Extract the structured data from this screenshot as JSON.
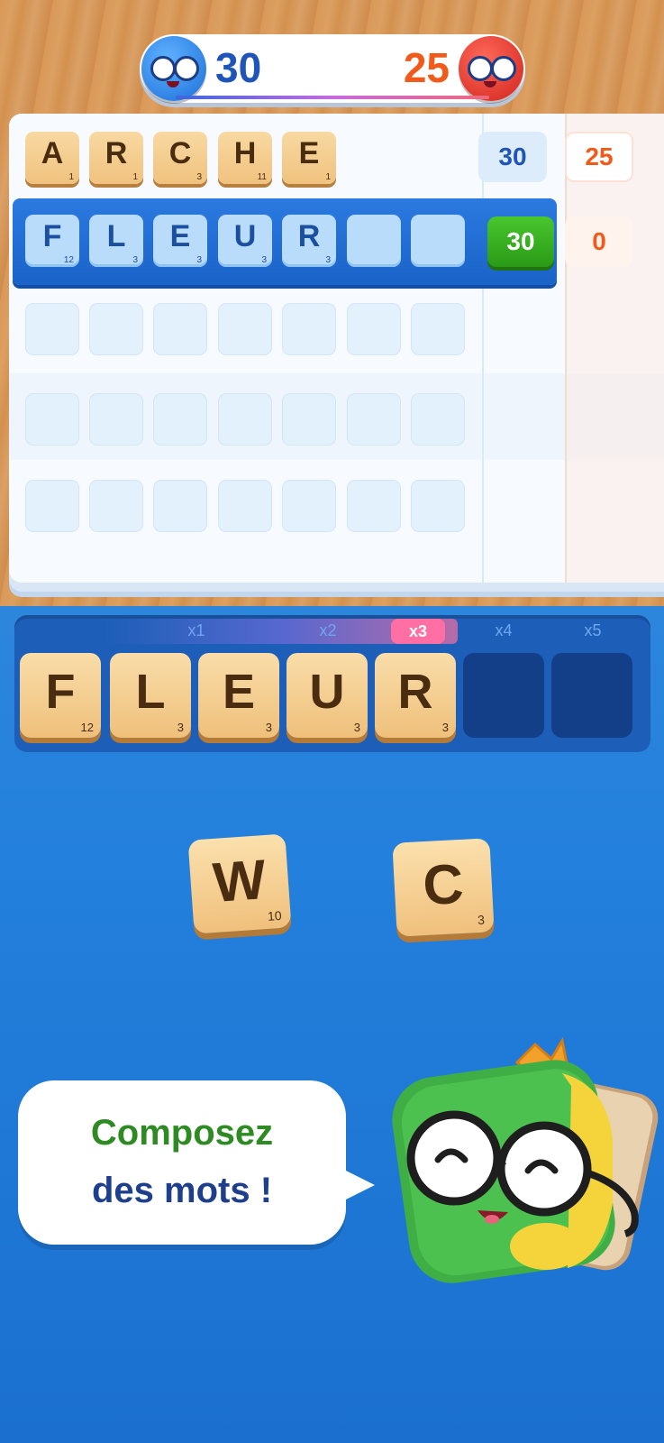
{
  "header": {
    "player1_score": "30",
    "player2_score": "25"
  },
  "board": {
    "rows": [
      {
        "tiles": [
          {
            "letter": "A",
            "points": "1"
          },
          {
            "letter": "R",
            "points": "1"
          },
          {
            "letter": "C",
            "points": "3"
          },
          {
            "letter": "H",
            "points": "11"
          },
          {
            "letter": "E",
            "points": "1"
          }
        ],
        "p1_score": "30",
        "p2_score": "25"
      },
      {
        "tiles": [
          {
            "letter": "F",
            "points": "12"
          },
          {
            "letter": "L",
            "points": "3"
          },
          {
            "letter": "E",
            "points": "3"
          },
          {
            "letter": "U",
            "points": "3"
          },
          {
            "letter": "R",
            "points": "3"
          }
        ],
        "p1_score": "30",
        "p2_score": "0"
      }
    ]
  },
  "rack": {
    "multipliers": [
      "x1",
      "x2",
      "x3",
      "x4",
      "x5"
    ],
    "tiles": [
      {
        "letter": "F",
        "points": "12"
      },
      {
        "letter": "L",
        "points": "3"
      },
      {
        "letter": "E",
        "points": "3"
      },
      {
        "letter": "U",
        "points": "3"
      },
      {
        "letter": "R",
        "points": "3"
      }
    ]
  },
  "loose_tiles": [
    {
      "letter": "W",
      "points": "10"
    },
    {
      "letter": "C",
      "points": "3"
    }
  ],
  "bubble": {
    "line1": "Composez",
    "line2": "des mots !"
  },
  "colors": {
    "player1": "#1f55b8",
    "player2": "#f05a1a",
    "bubble_line1": "#2e8a22",
    "bubble_line2": "#1d3f8c",
    "active_score": "#2a9a16"
  }
}
